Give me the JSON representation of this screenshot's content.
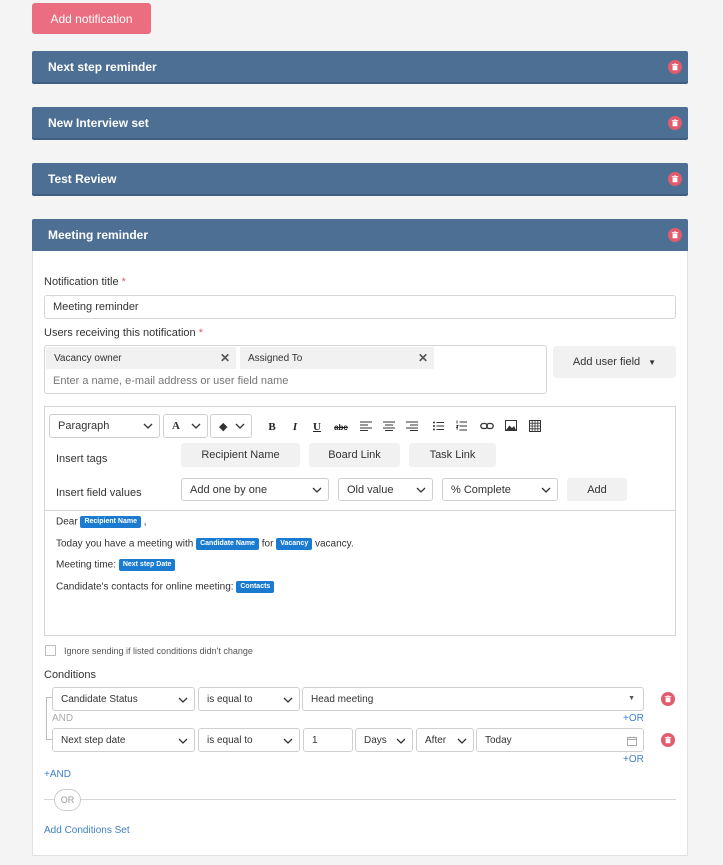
{
  "add_notification_label": "Add notification",
  "panels": [
    {
      "title": "Next step reminder"
    },
    {
      "title": "New Interview set"
    },
    {
      "title": "Test Review"
    },
    {
      "title": "Meeting reminder"
    }
  ],
  "form": {
    "title_label": "Notification title",
    "required_mark": "*",
    "title_value": "Meeting reminder",
    "users_label": "Users receiving this notification",
    "chips": [
      "Vacancy owner",
      "Assigned To"
    ],
    "users_placeholder": "Enter a name, e-mail address or user field name",
    "add_user_field": "Add user field"
  },
  "editor": {
    "paragraph": "Paragraph",
    "font_letter": "A",
    "toolbar": {
      "bold": "B",
      "italic": "I",
      "underline": "U",
      "strike": "abc"
    },
    "insert_tags_label": "Insert tags",
    "tags": [
      "Recipient Name",
      "Board Link",
      "Task Link"
    ],
    "insert_field_values_label": "Insert field values",
    "field_selects": [
      "Add one by one",
      "Old value",
      "% Complete"
    ],
    "add_label": "Add",
    "content": {
      "dear": "Dear",
      "tag_recipient": "Recipient Name",
      "comma": ",",
      "line2_a": "Today you have a meeting with",
      "tag_candidate": "Candidate Name",
      "line2_b": "for",
      "tag_vacancy": "Vacancy",
      "line2_c": "vacancy.",
      "line3": "Meeting time:",
      "tag_next_step": "Next step Date",
      "line4": "Candidate's contacts for online meeting:",
      "tag_contacts": "Contacts"
    }
  },
  "conditions": {
    "ignore_label": "Ignore sending if listed conditions didn't change",
    "label": "Conditions",
    "row1": {
      "field": "Candidate Status",
      "operator": "is equal to",
      "value": "Head meeting"
    },
    "and_label": "AND",
    "or_label": "+OR",
    "row2": {
      "field": "Next step date",
      "operator": "is equal to",
      "number": "1",
      "unit": "Days",
      "direction": "After",
      "value": "Today"
    },
    "add_and": "+AND",
    "or_divider": "OR",
    "add_set": "Add Conditions Set"
  },
  "colors": {
    "header": "#4d6f94",
    "accent": "#ea6e80",
    "tag": "#1a7bd0",
    "link": "#3f7fc7"
  }
}
